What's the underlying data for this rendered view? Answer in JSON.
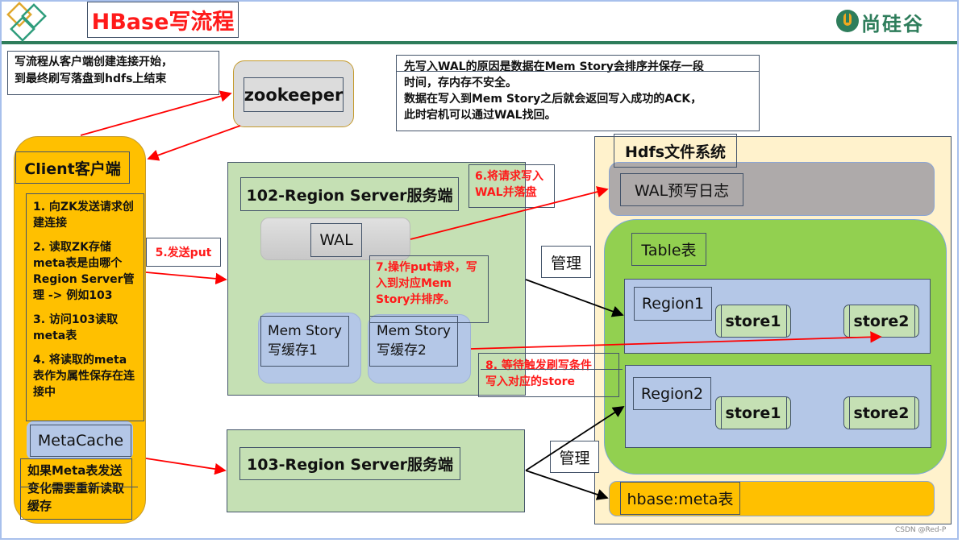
{
  "header": {
    "title": "HBase写流程",
    "brand": "尚硅谷"
  },
  "notes": {
    "overview": [
      "写流程从客户端创建连接开始，",
      "到最终刷写落盘到hdfs上结束"
    ],
    "wal_reason": [
      "先写入WAL的原因是数据在Mem Story会排序并保存一段",
      "时间，存内存不安全。",
      "数据在写入到Mem Story之后就会返回写入成功的ACK，",
      "此时宕机可以通过WAL找回。"
    ]
  },
  "zookeeper": {
    "label": "zookeeper"
  },
  "client": {
    "title": "Client客户端",
    "steps": [
      "1. 向ZK发送请求创建连接",
      "2. 读取ZK存储meta表是由哪个Region Server管理 -> 例如103",
      "3. 访问103读取meta表",
      "4. 将读取的meta表作为属性保存在连接中"
    ],
    "metacache": "MetaCache",
    "metacache_note": "如果Meta表发送变化需要重新读取缓存"
  },
  "flow_labels": {
    "step5": "5.发送put",
    "step6": "6.将请求写入WAL并落盘",
    "step7": "7.操作put请求，写入到对应Mem Story并排序。",
    "step8": [
      "8. 等待触发刷写条件",
      "写入对应的store"
    ],
    "manage": "管理"
  },
  "region_server_102": {
    "title": "102-Region Server服务端",
    "wal": "WAL",
    "memstores": [
      {
        "line1": "Mem Story",
        "line2": "写缓存1"
      },
      {
        "line1": "Mem Story",
        "line2": "写缓存2"
      }
    ]
  },
  "region_server_103": {
    "title": "103-Region Server服务端"
  },
  "hdfs": {
    "title": "Hdfs文件系统",
    "wal": "WAL预写日志",
    "table": "Table表",
    "regions": [
      {
        "label": "Region1",
        "stores": [
          "store1",
          "store2"
        ]
      },
      {
        "label": "Region2",
        "stores": [
          "store1",
          "store2"
        ]
      }
    ],
    "meta_table": "hbase:meta表"
  },
  "watermark": "CSDN @Red-P",
  "colors": {
    "title_red": "#ff1a1a",
    "client_orange": "#ffc000",
    "server_green": "#c5e0b4",
    "hdfs_cream": "#fff2cc",
    "table_green": "#92d050",
    "region_blue": "#b4c7e7",
    "brand_green": "#2e7d5b"
  }
}
